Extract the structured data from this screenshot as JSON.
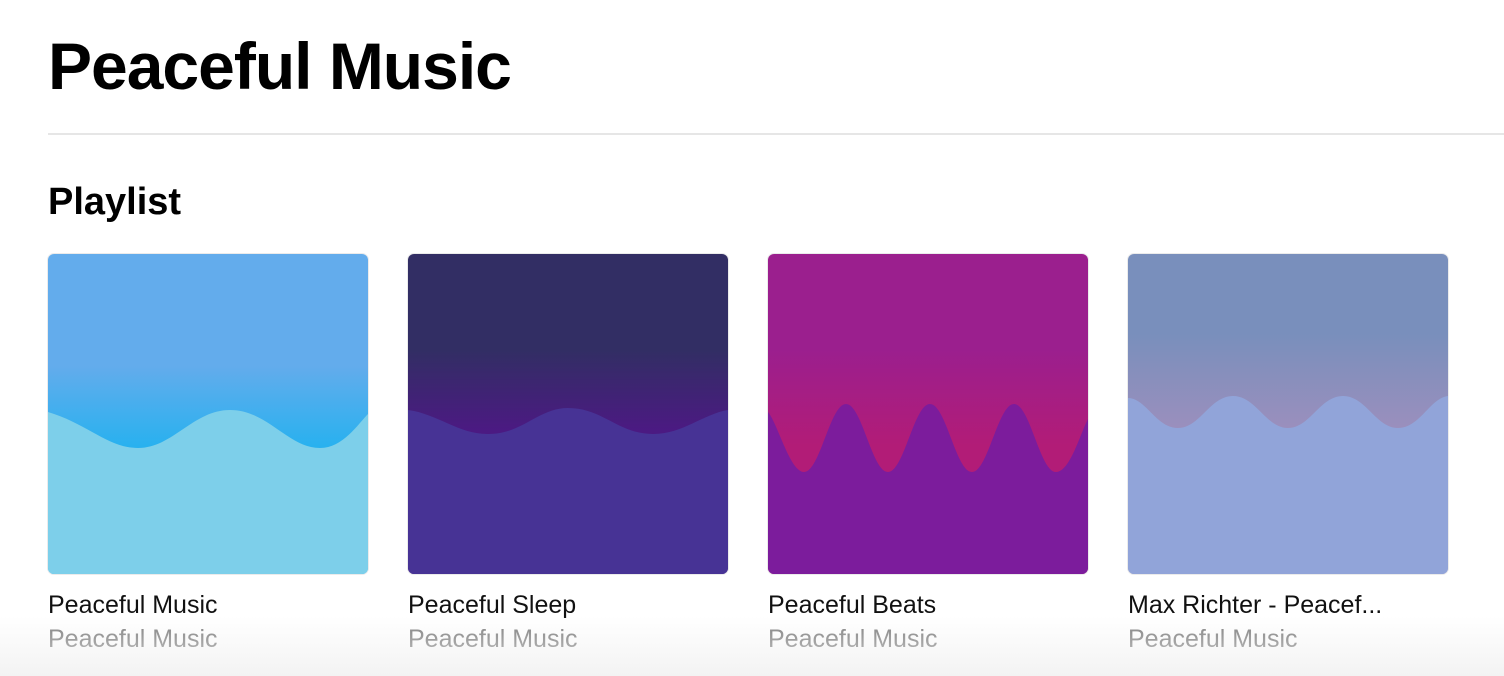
{
  "header": {
    "title": "Peaceful Music"
  },
  "section": {
    "title": "Playlist"
  },
  "playlists": [
    {
      "title": "Peaceful Music",
      "subtitle": "Peaceful Music",
      "art": {
        "top": "#63acec",
        "mid": "#29b1ef",
        "wave": "#7dcfea"
      }
    },
    {
      "title": "Peaceful Sleep",
      "subtitle": "Peaceful Music",
      "art": {
        "top": "#322e64",
        "mid": "#4b1a82",
        "wave": "#473395"
      }
    },
    {
      "title": "Peaceful Beats",
      "subtitle": "Peaceful Music",
      "art": {
        "top": "#9b1f8e",
        "mid": "#b21c77",
        "wave": "#7c1c9c"
      }
    },
    {
      "title": "Max Richter - Peacef...",
      "subtitle": "Peaceful Music",
      "art": {
        "top": "#798fbc",
        "mid": "#9b8fbd",
        "wave": "#91a4d9"
      }
    }
  ]
}
